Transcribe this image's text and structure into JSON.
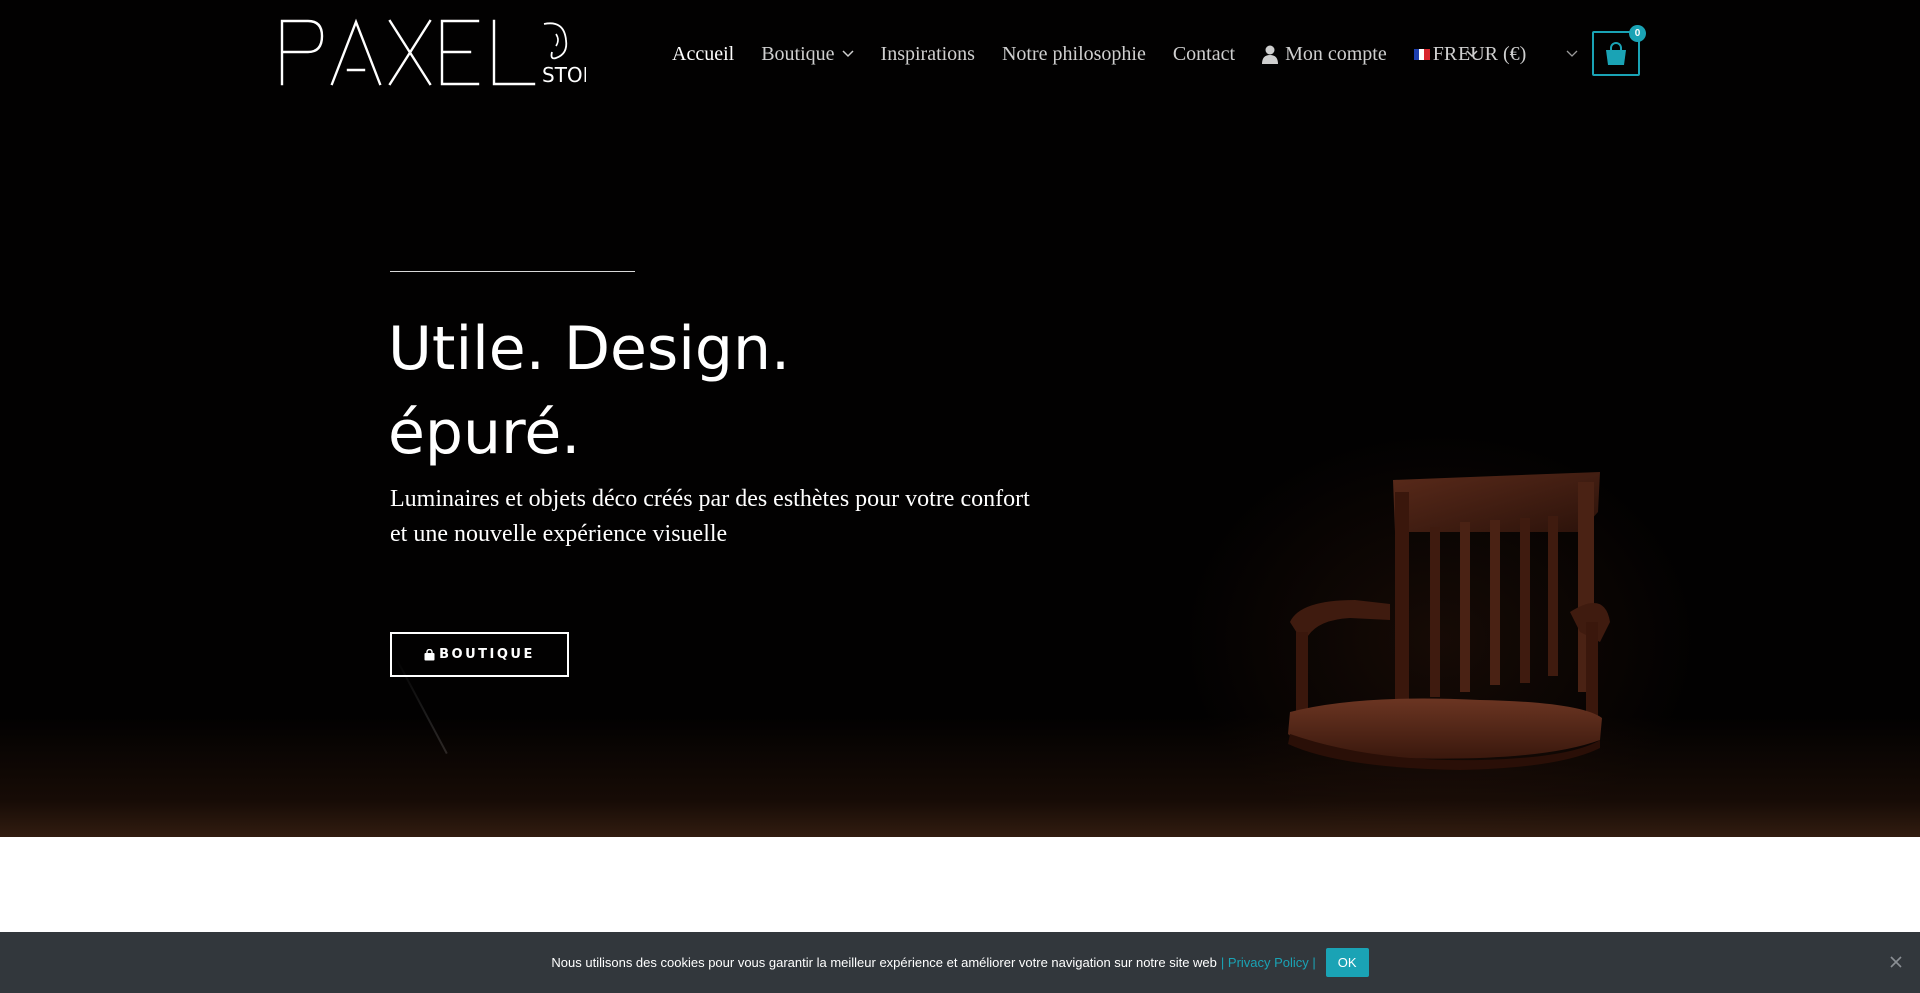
{
  "header": {
    "logo": {
      "brand": "PAXEL",
      "sub": "STORE"
    },
    "nav": {
      "home": "Accueil",
      "shop": "Boutique",
      "inspirations": "Inspirations",
      "philosophy": "Notre philosophie",
      "contact": "Contact",
      "account": "Mon compte",
      "language": "FR"
    },
    "currency": "EUR (€)",
    "cart": {
      "count": "0",
      "accent_color": "#1aa3b5"
    }
  },
  "hero": {
    "headline_line1": "Utile. Design.",
    "headline_line2": "épuré.",
    "subtitle_line1": "Luminaires et objets déco créés par des esthètes pour votre confort",
    "subtitle_line2": "et une nouvelle expérience visuelle",
    "cta_label": "BOUTIQUE",
    "icons": {
      "cta": "shopping-bag-icon",
      "image": "wooden-chair"
    }
  },
  "cookie_bar": {
    "message": "Nous utilisons des cookies pour vous garantir la meilleur expérience et améliorer votre navigation sur notre site web",
    "privacy_link": "| Privacy Policy |",
    "ok_label": "OK",
    "background": "#32373c"
  }
}
